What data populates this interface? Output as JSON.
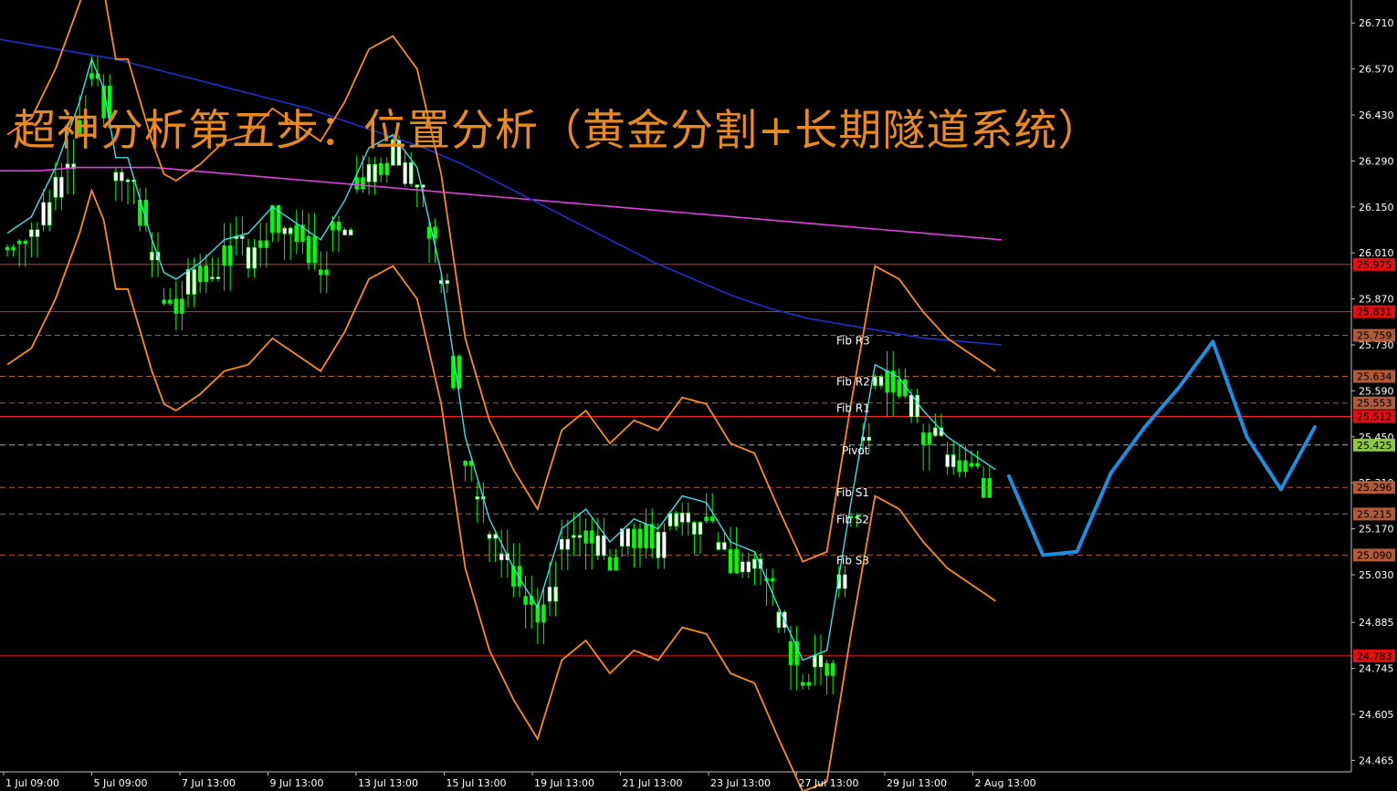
{
  "title": "超神分析第五步：位置分析（黄金分割+长期隧道系统）",
  "colors": {
    "background": "#000000",
    "bull_candle": "#00ff00",
    "bear_candle": "#ffffff",
    "bollinger": "#ff8c1a",
    "ma_long_cyan": "#3ee0e8",
    "ma_long_magenta": "#e040e0",
    "ma_blue": "#2030d0",
    "ma_red": "#d02010",
    "forecast": "#1e8fe0",
    "level_line": "#ff2020"
  },
  "chart_data": {
    "type": "candlestick",
    "y_axis": {
      "range": [
        24.43,
        26.78
      ],
      "ticks": [
        "26.710",
        "26.570",
        "26.430",
        "26.290",
        "26.150",
        "26.010",
        "25.870",
        "25.730",
        "25.590",
        "25.450",
        "25.310",
        "25.170",
        "25.030",
        "24.885",
        "24.745",
        "24.605",
        "24.465"
      ]
    },
    "x_axis": {
      "ticks": [
        "1 Jul 09:00",
        "5 Jul 09:00",
        "7 Jul 13:00",
        "9 Jul 13:00",
        "13 Jul 13:00",
        "15 Jul 13:00",
        "19 Jul 13:00",
        "21 Jul 13:00",
        "23 Jul 13:00",
        "27 Jul 13:00",
        "29 Jul 13:00",
        "2 Aug 13:00"
      ]
    },
    "price_levels": [
      {
        "value": 25.975,
        "label": "25.975",
        "style": "solid",
        "color": "#ff2020"
      },
      {
        "value": 25.831,
        "label": "25.831",
        "style": "solid",
        "color": "#ff2020"
      },
      {
        "value": 25.759,
        "label": "25.759",
        "style": "dash",
        "color": "#b05a3a"
      },
      {
        "value": 25.634,
        "label": "25.634",
        "style": "dash",
        "color": "#b05a3a"
      },
      {
        "value": 25.553,
        "label": "25.553",
        "style": "dash",
        "color": "#b05a3a"
      },
      {
        "value": 25.512,
        "label": "25.512",
        "style": "solid",
        "color": "#ff2020"
      },
      {
        "value": 25.425,
        "label": "25.425",
        "style": "dash",
        "color": "#b0b0b0"
      },
      {
        "value": 25.296,
        "label": "25.296",
        "style": "dash",
        "color": "#b05a3a"
      },
      {
        "value": 25.215,
        "label": "25.215",
        "style": "dash",
        "color": "#b05a3a"
      },
      {
        "value": 25.09,
        "label": "25.090",
        "style": "dash",
        "color": "#b05a3a"
      },
      {
        "value": 24.783,
        "label": "24.783",
        "style": "solid",
        "color": "#ff2020"
      }
    ],
    "fib_labels": [
      {
        "label": "Fib R3",
        "value": 25.759
      },
      {
        "label": "Fib R2",
        "value": 25.634
      },
      {
        "label": "Fib R1",
        "value": 25.553
      },
      {
        "label": "Pivot",
        "value": 25.425
      },
      {
        "label": "Fib S1",
        "value": 25.296
      },
      {
        "label": "Fib S2",
        "value": 25.215
      },
      {
        "label": "Fib S3",
        "value": 25.09
      }
    ],
    "price_path": [
      [
        0,
        26.02
      ],
      [
        2,
        26.07
      ],
      [
        4,
        26.22
      ],
      [
        6,
        26.42
      ],
      [
        7,
        26.55
      ],
      [
        8,
        26.46
      ],
      [
        9,
        26.25
      ],
      [
        10,
        26.25
      ],
      [
        12,
        26.0
      ],
      [
        13,
        25.9
      ],
      [
        14,
        25.88
      ],
      [
        16,
        25.93
      ],
      [
        18,
        26.0
      ],
      [
        20,
        26.02
      ],
      [
        22,
        26.1
      ],
      [
        24,
        26.05
      ],
      [
        26,
        26.0
      ],
      [
        28,
        26.12
      ],
      [
        30,
        26.28
      ],
      [
        32,
        26.32
      ],
      [
        34,
        26.22
      ],
      [
        36,
        25.9
      ],
      [
        38,
        25.4
      ],
      [
        40,
        25.15
      ],
      [
        42,
        25.0
      ],
      [
        44,
        24.88
      ],
      [
        46,
        25.12
      ],
      [
        48,
        25.18
      ],
      [
        50,
        25.08
      ],
      [
        52,
        25.15
      ],
      [
        54,
        25.12
      ],
      [
        56,
        25.22
      ],
      [
        58,
        25.2
      ],
      [
        60,
        25.08
      ],
      [
        62,
        25.05
      ],
      [
        64,
        24.88
      ],
      [
        66,
        24.72
      ],
      [
        68,
        24.75
      ],
      [
        70,
        25.2
      ],
      [
        72,
        25.62
      ],
      [
        74,
        25.58
      ],
      [
        76,
        25.48
      ],
      [
        78,
        25.4
      ],
      [
        80,
        25.35
      ],
      [
        82,
        25.3
      ]
    ],
    "series": [
      {
        "name": "",
        "values": [
          26.26,
          26.26,
          26.27,
          26.27,
          26.27,
          26.26,
          26.25,
          26.24,
          26.23,
          26.22,
          26.21,
          26.2,
          26.19,
          26.18,
          26.17,
          26.16,
          26.15,
          26.14,
          26.13,
          26.12,
          26.11,
          26.1,
          26.09,
          26.08,
          26.07,
          26.06,
          26.05
        ]
      },
      {
        "name": "",
        "values": [
          26.66,
          26.64,
          26.62,
          26.6,
          26.57,
          26.54,
          26.51,
          26.48,
          26.45,
          26.41,
          26.37,
          26.33,
          26.28,
          26.22,
          26.16,
          26.1,
          26.04,
          25.98,
          25.93,
          25.88,
          25.84,
          25.81,
          25.79,
          25.77,
          25.75,
          25.74,
          25.73
        ]
      }
    ],
    "forecast_path": [
      [
        0,
        25.33
      ],
      [
        1,
        25.09
      ],
      [
        2,
        25.1
      ],
      [
        3,
        25.34
      ],
      [
        4,
        25.48
      ],
      [
        5,
        25.6
      ],
      [
        6,
        25.74
      ],
      [
        7,
        25.45
      ],
      [
        8,
        25.29
      ],
      [
        9,
        25.48
      ]
    ],
    "annotations": [
      "Fib R3",
      "Fib R2",
      "Fib R1",
      "Pivot",
      "Fib S1",
      "Fib S2",
      "Fib S3"
    ]
  }
}
